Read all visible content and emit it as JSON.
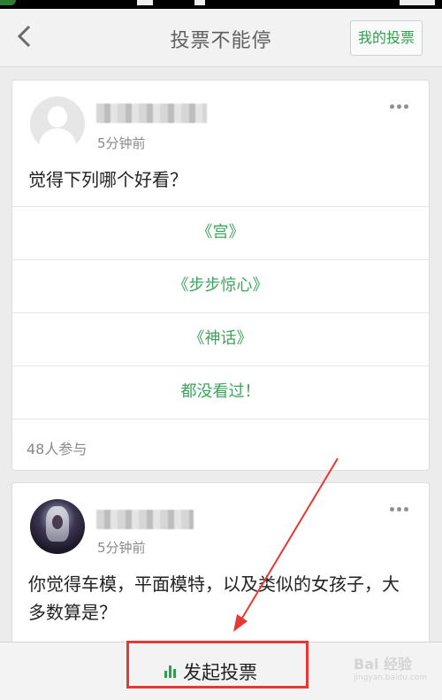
{
  "header": {
    "title": "投票不能停",
    "my_votes_label": "我的投票"
  },
  "posts": [
    {
      "time": "5分钟前",
      "question": "觉得下列哪个好看？",
      "options": [
        "《宫》",
        "《步步惊心》",
        "《神话》",
        "都没看过！"
      ],
      "participants": "48人参与"
    },
    {
      "time": "5分钟前",
      "question": "你觉得车模，平面模特，以及类似的女孩子，大多数算是？"
    }
  ],
  "footer": {
    "start_vote_label": "发起投票"
  },
  "watermark": {
    "logo": "Bai 经验",
    "url": "jingyan.baidu.com"
  },
  "colors": {
    "accent_green": "#3aa55b",
    "annotation_red": "#e53935"
  },
  "icons": {
    "back": "chevron-left-icon",
    "more": "more-dots-icon",
    "start_vote": "bar-chart-icon"
  }
}
